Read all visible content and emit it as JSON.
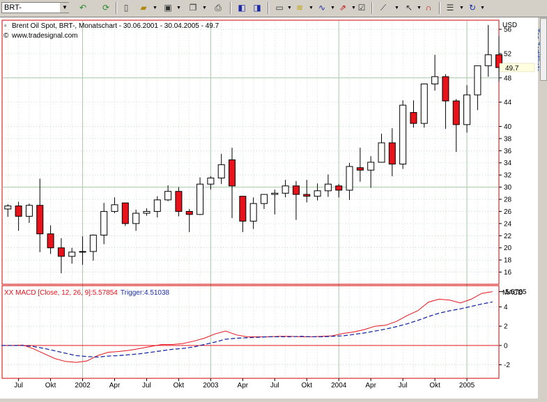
{
  "toolbar": {
    "symbol_value": "BRT-",
    "side_tab_label": "Top-Zertifikate"
  },
  "icons": [
    "undo-arrow-icon",
    "refresh-icon",
    "new-document-icon",
    "open-folder-icon",
    "save-icon",
    "copy-icon",
    "print-icon",
    "chart-prev-icon",
    "chart-next-icon",
    "window-icon",
    "indicator-icon",
    "line-tool-icon",
    "draw-tool-icon",
    "properties-icon",
    "crosshair-icon",
    "cursor-icon",
    "magnet-icon",
    "notes-icon",
    "rotate-icon"
  ],
  "colors": {
    "up_candle": "#ffffff",
    "down_candle": "#e8121b",
    "macd_line": "#e8121b",
    "trigger_line": "#1a2aa8",
    "frame": "#d00000",
    "grid": "#a8c8a8"
  },
  "chart_data": [
    {
      "type": "candlestick",
      "title": "Brent Oil Spot, BRT-, Monatschart - 30.06.2001 - 30.04.2005 - 49.7",
      "subtitle": "www.tradesignal.com",
      "yaxis_unit": "USD",
      "last_value": "49.7",
      "ylim": [
        14,
        57.5
      ],
      "yticks": [
        16,
        18,
        20,
        22,
        24,
        26,
        28,
        30,
        32,
        34,
        36,
        38,
        40,
        44,
        48,
        52,
        56
      ],
      "ytick_labels": [
        "16",
        "18",
        "20",
        "22",
        "24",
        "26",
        "28",
        "30",
        "32",
        "34",
        "36",
        "38",
        "40",
        "44",
        "48",
        "52",
        "56"
      ],
      "month_index_start": "2001-06",
      "xtick_labels": [
        {
          "m": 1,
          "label": "Jul"
        },
        {
          "m": 4,
          "label": "Okt"
        },
        {
          "m": 7,
          "label": "2002"
        },
        {
          "m": 10,
          "label": "Apr"
        },
        {
          "m": 13,
          "label": "Jul"
        },
        {
          "m": 16,
          "label": "Okt"
        },
        {
          "m": 19,
          "label": "2003"
        },
        {
          "m": 22,
          "label": "Apr"
        },
        {
          "m": 25,
          "label": "Jul"
        },
        {
          "m": 28,
          "label": "Okt"
        },
        {
          "m": 31,
          "label": "2004"
        },
        {
          "m": 34,
          "label": "Apr"
        },
        {
          "m": 37,
          "label": "Jul"
        },
        {
          "m": 40,
          "label": "Okt"
        },
        {
          "m": 43,
          "label": "2005"
        }
      ],
      "ohlc": [
        [
          26.4,
          27.2,
          25.1,
          26.9
        ],
        [
          26.9,
          27.6,
          22.8,
          25.2
        ],
        [
          25.2,
          27.3,
          24.1,
          27.0
        ],
        [
          27.0,
          31.4,
          19.3,
          22.3
        ],
        [
          22.3,
          23.7,
          19.0,
          20.0
        ],
        [
          20.0,
          21.6,
          15.8,
          18.6
        ],
        [
          18.6,
          20.0,
          17.4,
          19.3
        ],
        [
          19.3,
          21.9,
          17.2,
          19.4
        ],
        [
          19.4,
          22.2,
          17.9,
          22.1
        ],
        [
          22.1,
          27.4,
          20.6,
          26.0
        ],
        [
          26.0,
          28.3,
          25.7,
          27.1
        ],
        [
          27.4,
          27.4,
          23.6,
          24.0
        ],
        [
          24.0,
          26.3,
          22.8,
          25.7
        ],
        [
          25.7,
          26.5,
          25.3,
          26.0
        ],
        [
          26.0,
          28.5,
          25.0,
          27.9
        ],
        [
          27.9,
          30.3,
          27.7,
          29.3
        ],
        [
          29.3,
          30.0,
          25.2,
          26.0
        ],
        [
          26.0,
          26.4,
          22.6,
          25.5
        ],
        [
          25.5,
          31.6,
          25.4,
          30.5
        ],
        [
          30.5,
          31.8,
          29.6,
          31.5
        ],
        [
          31.5,
          35.5,
          30.5,
          33.7
        ],
        [
          34.5,
          36.5,
          24.9,
          30.2
        ],
        [
          28.5,
          28.5,
          22.6,
          24.4
        ],
        [
          24.4,
          28.3,
          23.1,
          27.3
        ],
        [
          27.3,
          28.7,
          26.4,
          28.8
        ],
        [
          28.8,
          29.6,
          25.5,
          29.0
        ],
        [
          29.0,
          31.2,
          28.3,
          30.2
        ],
        [
          30.2,
          31.0,
          24.6,
          28.8
        ],
        [
          28.8,
          31.2,
          27.5,
          28.5
        ],
        [
          28.5,
          30.6,
          27.8,
          29.4
        ],
        [
          29.4,
          32.1,
          28.4,
          30.5
        ],
        [
          30.2,
          30.5,
          28.3,
          29.5
        ],
        [
          29.5,
          34.0,
          27.9,
          33.4
        ],
        [
          33.2,
          36.5,
          30.9,
          32.8
        ],
        [
          32.8,
          35.1,
          29.9,
          34.1
        ],
        [
          34.1,
          38.8,
          34.1,
          37.3
        ],
        [
          37.3,
          39.7,
          31.8,
          33.8
        ],
        [
          33.8,
          44.3,
          33.0,
          43.5
        ],
        [
          42.3,
          44.3,
          39.8,
          40.5
        ],
        [
          40.5,
          44.4,
          39.8,
          47.0
        ],
        [
          47.0,
          51.8,
          45.9,
          48.2
        ],
        [
          48.2,
          48.6,
          39.6,
          44.2
        ],
        [
          44.2,
          44.5,
          35.8,
          40.3
        ],
        [
          40.3,
          46.8,
          39.0,
          45.2
        ],
        [
          45.2,
          49.8,
          42.7,
          50.0
        ],
        [
          50.0,
          56.7,
          48.2,
          51.8
        ],
        [
          51.8,
          54.9,
          47.4,
          49.7
        ]
      ]
    },
    {
      "type": "line",
      "title": "XX MACD [Close, 12, 26, 9]:5.57854",
      "trigger_label": "Trigger:4.51038",
      "yaxis_label": "MACD",
      "last_value": "5.5785",
      "ylim": [
        -3.4,
        6.2
      ],
      "yticks": [
        -2,
        0,
        2,
        4
      ],
      "ytick_labels": [
        "-2",
        "0",
        "2",
        "4"
      ],
      "series": [
        {
          "name": "MACD",
          "values": [
            0.0,
            0.0,
            0.05,
            -0.35,
            -0.85,
            -1.35,
            -1.65,
            -1.75,
            -1.6,
            -1.05,
            -0.7,
            -0.62,
            -0.5,
            -0.3,
            -0.1,
            0.1,
            0.1,
            0.2,
            0.45,
            0.75,
            1.2,
            1.5,
            1.1,
            0.9,
            0.9,
            0.9,
            0.95,
            0.95,
            0.9,
            0.9,
            0.95,
            1.0,
            1.25,
            1.4,
            1.65,
            2.0,
            2.1,
            2.5,
            3.1,
            3.6,
            4.5,
            4.8,
            4.7,
            4.4,
            4.8,
            5.4,
            5.58
          ]
        },
        {
          "name": "Trigger",
          "values": [
            0.0,
            0.0,
            0.0,
            -0.1,
            -0.3,
            -0.55,
            -0.8,
            -1.05,
            -1.15,
            -1.2,
            -1.1,
            -1.05,
            -0.95,
            -0.85,
            -0.7,
            -0.55,
            -0.4,
            -0.3,
            -0.15,
            0.1,
            0.35,
            0.65,
            0.75,
            0.8,
            0.85,
            0.9,
            0.9,
            0.9,
            0.95,
            0.9,
            0.9,
            0.95,
            1.0,
            1.15,
            1.3,
            1.5,
            1.7,
            1.95,
            2.25,
            2.6,
            3.0,
            3.35,
            3.6,
            3.8,
            4.05,
            4.3,
            4.51
          ]
        }
      ]
    }
  ]
}
